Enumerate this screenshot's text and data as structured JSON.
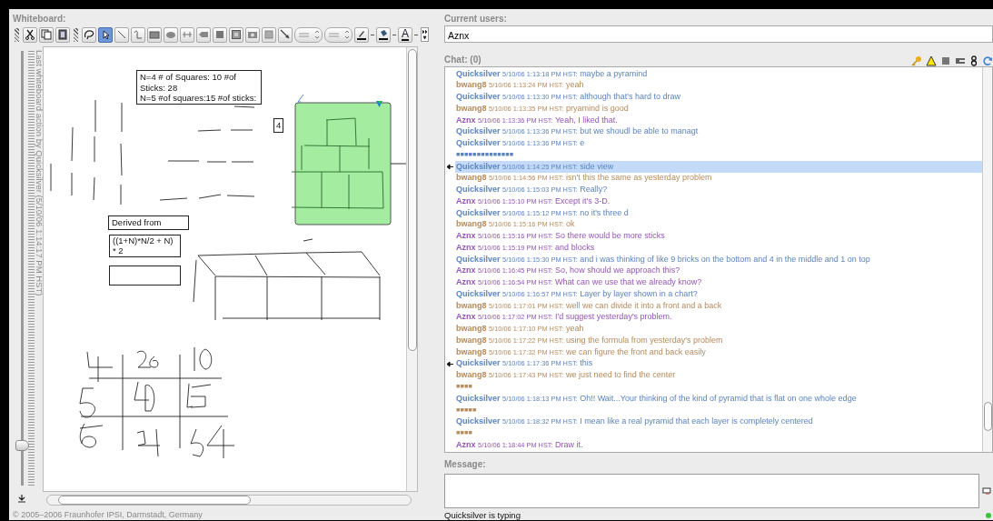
{
  "whiteboard": {
    "title": "Whiteboard:",
    "tools": [
      {
        "kind": "cut",
        "selected": false
      },
      {
        "kind": "copy",
        "selected": false
      },
      {
        "kind": "paste",
        "selected": false
      },
      {
        "kind": "lasso",
        "selected": false
      },
      {
        "kind": "pointer",
        "selected": true
      },
      {
        "kind": "line",
        "selected": false
      },
      {
        "kind": "freeform",
        "selected": false
      },
      {
        "kind": "rectangle",
        "selected": false
      },
      {
        "kind": "ellipse",
        "selected": false
      },
      {
        "kind": "link",
        "selected": false
      },
      {
        "kind": "label",
        "selected": false
      },
      {
        "kind": "fill",
        "selected": false
      },
      {
        "kind": "frame",
        "selected": false
      },
      {
        "kind": "camera",
        "selected": false
      },
      {
        "kind": "picture",
        "selected": false
      },
      {
        "kind": "connector",
        "selected": false
      },
      {
        "kind": "stepper",
        "selected": false
      },
      {
        "kind": "stepper",
        "selected": false
      },
      {
        "kind": "pen",
        "selected": false
      },
      {
        "kind": "bucket",
        "selected": false
      },
      {
        "kind": "font-color",
        "label": "A",
        "selected": false
      }
    ],
    "last_action": "Last whiteboard action by Quicksilver (5/10/06 1:14:17 PM HST)",
    "zoom_slider": {
      "level": 0.09
    },
    "notes": [
      {
        "kind": "note",
        "lines": [
          "N=4 # of Squares: 10 #of",
          "Sticks: 28",
          "N=5 #of squares:15 #of sticks:"
        ]
      },
      {
        "kind": "tag",
        "lines": [
          "4"
        ]
      },
      {
        "kind": "label",
        "lines": [
          "Derived from"
        ]
      },
      {
        "kind": "formula",
        "lines": [
          "((1+N)*N/2 + N)",
          "* 2"
        ]
      },
      {
        "kind": "empty"
      }
    ],
    "copyright": "© 2005–2006 Fraunhofer IPSI, Darmstadt, Germany"
  },
  "chat": {
    "users_label": "Current users:",
    "users": [
      "Aznx"
    ],
    "title": "Chat: (0)",
    "messages": [
      {
        "kind": "message",
        "user": "Quicksilver",
        "time": "5/10/06 1:13:18 PM HST:",
        "text": "maybe a pyramind",
        "color": "#5b84bf",
        "selected": false,
        "marked": false
      },
      {
        "kind": "message",
        "user": "bwang8",
        "time": "5/10/06 1:13:24 PM HST:",
        "text": "yeah",
        "color": "#b68a5c",
        "selected": false,
        "marked": false
      },
      {
        "kind": "message",
        "user": "Quicksilver",
        "time": "5/10/06 1:13:30 PM HST:",
        "text": "although that's hard to draw",
        "color": "#5b84bf",
        "selected": false,
        "marked": false
      },
      {
        "kind": "message",
        "user": "bwang8",
        "time": "5/10/06 1:13:35 PM HST:",
        "text": "pryamind is good",
        "color": "#b68a5c",
        "selected": false,
        "marked": false
      },
      {
        "kind": "message",
        "user": "Aznx",
        "time": "5/10/06 1:13:36 PM HST:",
        "text": "Yeah, I liked that.",
        "color": "#9555b5",
        "selected": false,
        "marked": false
      },
      {
        "kind": "message",
        "user": "Quicksilver",
        "time": "5/10/06 1:13:36 PM HST:",
        "text": "but we shoudl be able to managt",
        "color": "#5b84bf",
        "selected": false,
        "marked": false
      },
      {
        "kind": "message",
        "user": "Quicksilver",
        "time": "5/10/06 1:13:36 PM HST:",
        "text": "e",
        "color": "#5b84bf",
        "selected": false,
        "marked": false
      },
      {
        "kind": "typing",
        "text": "■■■■■■■■■■■■■■",
        "color": "#5b84bf",
        "selected": false,
        "marked": false
      },
      {
        "kind": "message",
        "user": "Quicksilver",
        "time": "5/10/06 1:14:25 PM HST:",
        "text": "side view",
        "color": "#5b84bf",
        "selected": true,
        "marked": true
      },
      {
        "kind": "message",
        "user": "bwang8",
        "time": "5/10/06 1:14:56 PM HST:",
        "text": "isn't this the same as yesterday problem",
        "color": "#b68a5c",
        "selected": false,
        "marked": false
      },
      {
        "kind": "message",
        "user": "Quicksilver",
        "time": "5/10/06 1:15:03 PM HST:",
        "text": "Really?",
        "color": "#5b84bf",
        "selected": false,
        "marked": false
      },
      {
        "kind": "message",
        "user": "Aznx",
        "time": "5/10/06 1:15:10 PM HST:",
        "text": "Except it's 3-D.",
        "color": "#9555b5",
        "selected": false,
        "marked": false
      },
      {
        "kind": "message",
        "user": "Quicksilver",
        "time": "5/10/06 1:15:12 PM HST:",
        "text": "no it's three d",
        "color": "#5b84bf",
        "selected": false,
        "marked": false
      },
      {
        "kind": "message",
        "user": "bwang8",
        "time": "5/10/06 1:15:16 PM HST:",
        "text": "ok",
        "color": "#b68a5c",
        "selected": false,
        "marked": false
      },
      {
        "kind": "message",
        "user": "Aznx",
        "time": "5/10/06 1:15:16 PM HST:",
        "text": "So there would be more sticks",
        "color": "#9555b5",
        "selected": false,
        "marked": false
      },
      {
        "kind": "message",
        "user": "Aznx",
        "time": "5/10/06 1:15:19 PM HST:",
        "text": "and blocks",
        "color": "#9555b5",
        "selected": false,
        "marked": false
      },
      {
        "kind": "message",
        "user": "Quicksilver",
        "time": "5/10/06 1:15:30 PM HST:",
        "text": "and i was thinking of like 9 bricks on the bottom and 4 in the middle and 1 on top",
        "color": "#5b84bf",
        "selected": false,
        "marked": false
      },
      {
        "kind": "message",
        "user": "Aznx",
        "time": "5/10/06 1:16:45 PM HST:",
        "text": "So, how should we approach this?",
        "color": "#9555b5",
        "selected": false,
        "marked": false
      },
      {
        "kind": "message",
        "user": "Aznx",
        "time": "5/10/06 1:16:54 PM HST:",
        "text": "What can we use that we already know?",
        "color": "#9555b5",
        "selected": false,
        "marked": false
      },
      {
        "kind": "message",
        "user": "Quicksilver",
        "time": "5/10/06 1:16:57 PM HST:",
        "text": "Layer by layer shown in a chart?",
        "color": "#5b84bf",
        "selected": false,
        "marked": false
      },
      {
        "kind": "message",
        "user": "bwang8",
        "time": "5/10/06 1:17:01 PM HST:",
        "text": "well we can divide it into a front and a back",
        "color": "#b68a5c",
        "selected": false,
        "marked": false
      },
      {
        "kind": "message",
        "user": "Aznx",
        "time": "5/10/06 1:17:02 PM HST:",
        "text": "I'd suggest yesterday's problem.",
        "color": "#9555b5",
        "selected": false,
        "marked": false
      },
      {
        "kind": "message",
        "user": "bwang8",
        "time": "5/10/06 1:17:10 PM HST:",
        "text": "yeah",
        "color": "#b68a5c",
        "selected": false,
        "marked": false
      },
      {
        "kind": "message",
        "user": "bwang8",
        "time": "5/10/06 1:17:22 PM HST:",
        "text": "using the formula from yesterday's problem",
        "color": "#b68a5c",
        "selected": false,
        "marked": false
      },
      {
        "kind": "message",
        "user": "bwang8",
        "time": "5/10/06 1:17:32 PM HST:",
        "text": "we can figure the front and back easily",
        "color": "#b68a5c",
        "selected": false,
        "marked": false
      },
      {
        "kind": "message",
        "user": "Quicksilver",
        "time": "5/10/06 1:17:36 PM HST:",
        "text": "this",
        "color": "#5b84bf",
        "selected": false,
        "marked": true
      },
      {
        "kind": "message",
        "user": "bwang8",
        "time": "5/10/06 1:17:43 PM HST:",
        "text": "we just need to find the center",
        "color": "#b68a5c",
        "selected": false,
        "marked": false
      },
      {
        "kind": "typing",
        "text": "■■■■",
        "color": "#b68a5c",
        "selected": false,
        "marked": false
      },
      {
        "kind": "message",
        "user": "Quicksilver",
        "time": "5/10/06 1:18:13 PM HST:",
        "text": "Oh!! Wait...Your thinking of the kind of pyramid that is flat on one whole edge",
        "color": "#5b84bf",
        "selected": false,
        "marked": false
      },
      {
        "kind": "typing",
        "text": "■■■■■",
        "color": "#b68a5c",
        "selected": false,
        "marked": false
      },
      {
        "kind": "message",
        "user": "Quicksilver",
        "time": "5/10/06 1:18:32 PM HST:",
        "text": "I mean like a real pyramid that each layer is completely centered",
        "color": "#5b84bf",
        "selected": false,
        "marked": false
      },
      {
        "kind": "typing",
        "text": "■■■■",
        "color": "#b68a5c",
        "selected": false,
        "marked": false
      },
      {
        "kind": "message",
        "user": "Aznx",
        "time": "5/10/06 1:18:44 PM HST:",
        "text": "Draw it.",
        "color": "#9555b5",
        "selected": false,
        "marked": false
      }
    ],
    "message_label": "Message:",
    "status": "Quicksilver is typing"
  }
}
